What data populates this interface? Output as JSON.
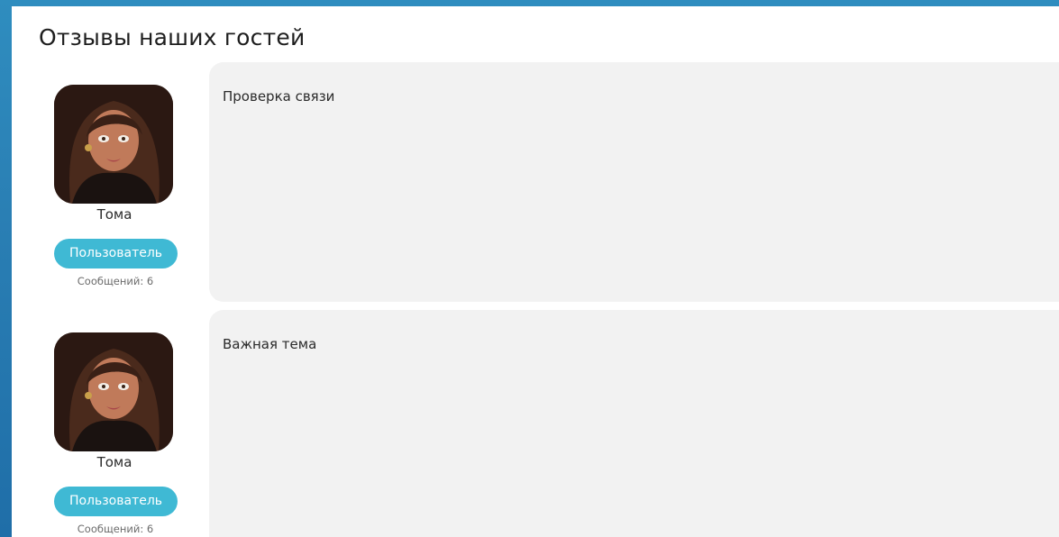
{
  "section": {
    "title": "Отзывы наших гостей"
  },
  "reviews": [
    {
      "author": "Тома",
      "role": "Пользователь",
      "messages": "Сообщений: 6",
      "text": "Проверка связи"
    },
    {
      "author": "Тома",
      "role": "Пользователь",
      "messages": "Сообщений: 6",
      "text": "Важная тема"
    }
  ],
  "colors": {
    "background_accent": "#2f8dbf",
    "badge": "#3fb9d4",
    "card": "#f2f2f2"
  },
  "icons": {
    "avatar": "user-avatar-illustration"
  }
}
